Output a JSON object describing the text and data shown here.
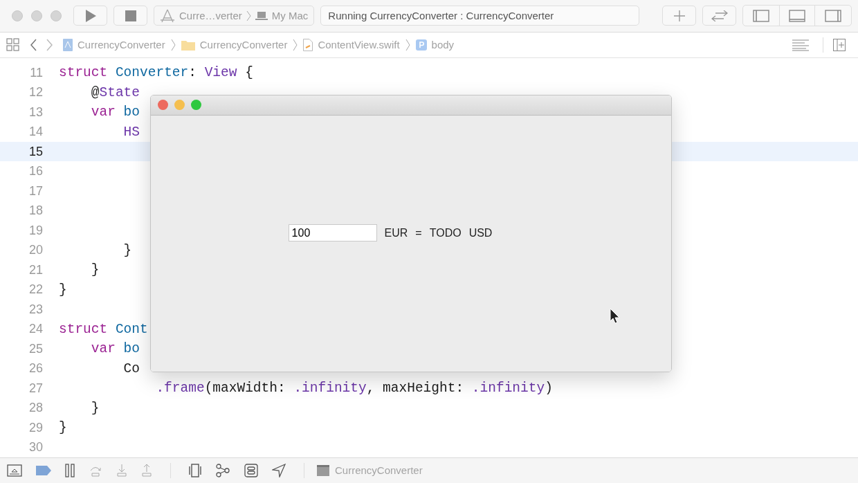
{
  "toolbar": {
    "scheme": "Curre…verter",
    "destination": "My Mac",
    "activity": "Running CurrencyConverter : CurrencyConverter",
    "panels": [
      {
        "kind": "navigator",
        "on": false
      },
      {
        "kind": "debug",
        "on": false
      },
      {
        "kind": "inspector",
        "on": false
      }
    ]
  },
  "breadcrumbs": [
    {
      "kind": "project",
      "label": "CurrencyConverter"
    },
    {
      "kind": "folder",
      "label": "CurrencyConverter"
    },
    {
      "kind": "file",
      "label": "ContentView.swift"
    },
    {
      "kind": "property",
      "label": "body"
    }
  ],
  "editor": {
    "lines": [
      {
        "number": "11",
        "current": false,
        "tokens": [
          {
            "kind": "keyword",
            "text": "struct"
          },
          {
            "kind": "decl",
            "text": " Converter"
          },
          {
            "kind": "plain",
            "text": ": "
          },
          {
            "kind": "type",
            "text": "View"
          },
          {
            "kind": "plain",
            "text": " {"
          }
        ]
      },
      {
        "number": "12",
        "current": false,
        "tokens": [
          {
            "kind": "plain",
            "text": "    @"
          },
          {
            "kind": "type",
            "text": "State"
          }
        ]
      },
      {
        "number": "13",
        "current": false,
        "tokens": [
          {
            "kind": "keyword",
            "text": "    var"
          },
          {
            "kind": "decl",
            "text": " bo"
          }
        ]
      },
      {
        "number": "14",
        "current": false,
        "tokens": [
          {
            "kind": "type",
            "text": "        HS"
          }
        ]
      },
      {
        "number": "15",
        "current": true
      },
      {
        "number": "16",
        "current": false
      },
      {
        "number": "17",
        "current": false
      },
      {
        "number": "18",
        "current": false
      },
      {
        "number": "19",
        "current": false
      },
      {
        "number": "20",
        "current": false,
        "tokens": [
          {
            "kind": "plain",
            "text": "        }"
          }
        ]
      },
      {
        "number": "21",
        "current": false,
        "tokens": [
          {
            "kind": "plain",
            "text": "    }"
          }
        ]
      },
      {
        "number": "22",
        "current": false,
        "tokens": [
          {
            "kind": "plain",
            "text": "}"
          }
        ]
      },
      {
        "number": "23",
        "current": false
      },
      {
        "number": "24",
        "current": false,
        "tokens": [
          {
            "kind": "keyword",
            "text": "struct"
          },
          {
            "kind": "decl",
            "text": " Cont"
          }
        ]
      },
      {
        "number": "25",
        "current": false,
        "tokens": [
          {
            "kind": "keyword",
            "text": "    var"
          },
          {
            "kind": "decl",
            "text": " bo"
          }
        ]
      },
      {
        "number": "26",
        "current": false,
        "tokens": [
          {
            "kind": "plain",
            "text": "        Co"
          }
        ]
      },
      {
        "number": "27",
        "current": false,
        "tokens": [
          {
            "kind": "method",
            "text": "            .frame"
          },
          {
            "kind": "plain",
            "text": "(maxWidth: "
          },
          {
            "kind": "method",
            "text": ".infinity"
          },
          {
            "kind": "plain",
            "text": ", maxHeight: "
          },
          {
            "kind": "method",
            "text": ".infinity"
          },
          {
            "kind": "plain",
            "text": ")"
          }
        ]
      },
      {
        "number": "28",
        "current": false,
        "tokens": [
          {
            "kind": "plain",
            "text": "    }"
          }
        ]
      },
      {
        "number": "29",
        "current": false,
        "tokens": [
          {
            "kind": "plain",
            "text": "}"
          }
        ]
      },
      {
        "number": "30",
        "current": false
      }
    ]
  },
  "app_window": {
    "amount": "100",
    "from": "EUR",
    "equals": "=",
    "result": "TODO",
    "to": "USD"
  },
  "debug_bar": {
    "target": "CurrencyConverter"
  }
}
